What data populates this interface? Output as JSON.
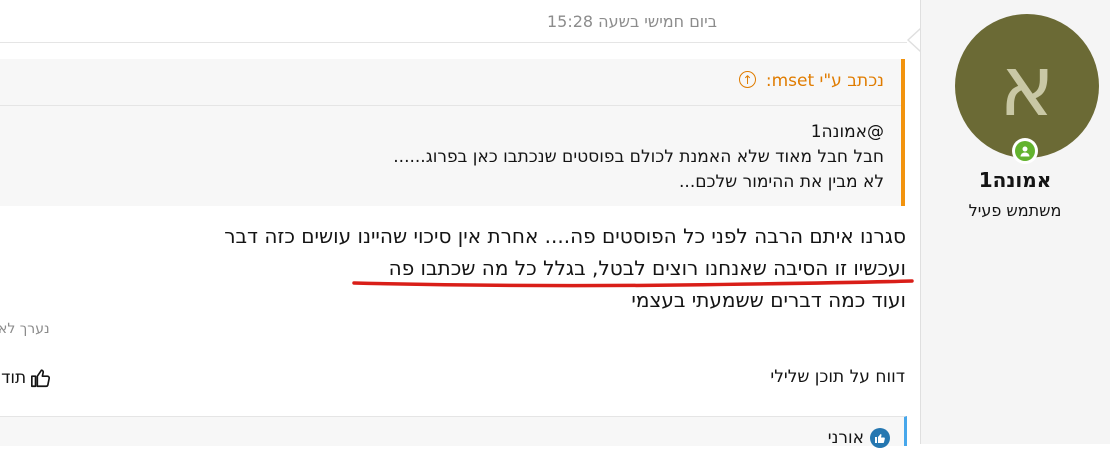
{
  "post": {
    "timestamp": "ביום חמישי בשעה 15:28",
    "quote": {
      "author_label": "נכתב ע\"י mset:",
      "lines": [
        "@אמונה1",
        "חבל חבל מאוד שלא האמנת לכולם בפוסטים שנכתבו כאן בפרוג......",
        "לא מבין את ההימור שלכם..."
      ]
    },
    "message_lines": [
      "סגרנו איתם הרבה לפני כל הפוסטים פה.... אחרת אין סיכוי שהיינו עושים כזה דבר",
      "ועכשיו זו הסיבה שאנחנו רוצים לבטל, בגלל כל מה שכתבו פה",
      "ועוד כמה דברים ששמעתי בעצמי"
    ],
    "edited_label": "נערך לא",
    "report_label": "דווח על תוכן שלילי",
    "thanks_label": "תודה",
    "reactions": {
      "user": "אורני"
    },
    "colors": {
      "quote_accent": "#f2930d",
      "underline": "#d91e18",
      "avatar_bg": "#6b6a35",
      "online": "#63b32e",
      "like": "#2577b1"
    }
  },
  "author": {
    "avatar_letter": "א",
    "name": "אמונה1",
    "title": "משתמש פעיל"
  }
}
